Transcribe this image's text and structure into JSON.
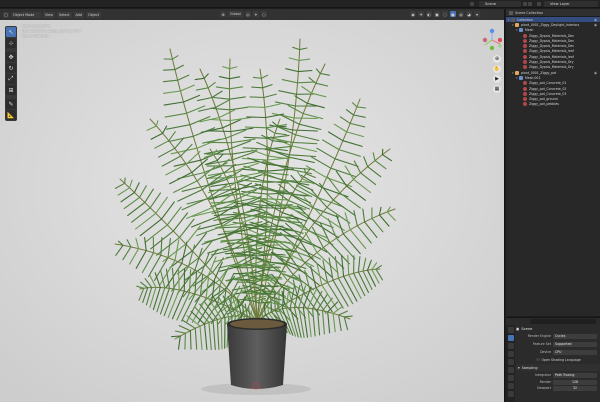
{
  "topbar": {
    "scene_name": "Scene",
    "view_layer": "View Layer"
  },
  "viewport_header": {
    "mode": "Object Mode",
    "menus": [
      "View",
      "Select",
      "Add",
      "Object"
    ],
    "orientation": "Global",
    "shading_label": "Options"
  },
  "viewport_overlay": {
    "lines": [
      "User Perspective",
      "(1) Collection | Ziggy_Bambo_Palm",
      "Scene Statistics"
    ]
  },
  "outliner": {
    "title": "Scene Collection",
    "rows": [
      {
        "label": "Collection",
        "indent": 0,
        "icon": "coll",
        "selected": true
      },
      {
        "label": "plant_0001_Ziggy_Daylight_Interiors",
        "indent": 1,
        "icon": "obj",
        "selected": false
      },
      {
        "label": "Mesh",
        "indent": 2,
        "icon": "mod",
        "selected": false
      },
      {
        "label": "Ziggy_Dypsis_Materials_Dec",
        "indent": 3,
        "icon": "mat",
        "selected": false
      },
      {
        "label": "Ziggy_Dypsis_Materials_Dec",
        "indent": 3,
        "icon": "mat",
        "selected": false
      },
      {
        "label": "Ziggy_Dypsis_Materials_Dec",
        "indent": 3,
        "icon": "mat",
        "selected": false
      },
      {
        "label": "Ziggy_Dypsis_Materials_leaf",
        "indent": 3,
        "icon": "mat",
        "selected": false
      },
      {
        "label": "Ziggy_Dypsis_Materials_leaf",
        "indent": 3,
        "icon": "mat",
        "selected": false
      },
      {
        "label": "Ziggy_Dypsis_Materials_Dry",
        "indent": 3,
        "icon": "mat",
        "selected": false
      },
      {
        "label": "Ziggy_Dypsis_Materials_Dry",
        "indent": 3,
        "icon": "mat",
        "selected": false
      },
      {
        "label": "plant_0001_Ziggy_pot",
        "indent": 1,
        "icon": "obj",
        "selected": false
      },
      {
        "label": "Mesh.001",
        "indent": 2,
        "icon": "mod",
        "selected": false
      },
      {
        "label": "Ziggy_pot_Concrete_01",
        "indent": 3,
        "icon": "mat",
        "selected": false
      },
      {
        "label": "Ziggy_pot_Concrete_02",
        "indent": 3,
        "icon": "mat",
        "selected": false
      },
      {
        "label": "Ziggy_pot_Concrete_03",
        "indent": 3,
        "icon": "mat",
        "selected": false
      },
      {
        "label": "Ziggy_pot_ground",
        "indent": 3,
        "icon": "mat",
        "selected": false
      },
      {
        "label": "Ziggy_pot_pebbles",
        "indent": 3,
        "icon": "mat",
        "selected": false
      }
    ]
  },
  "properties": {
    "section_title": "Scene",
    "render_engine_label": "Render Engine",
    "render_engine_value": "Cycles",
    "feature_set_label": "Feature Set",
    "feature_set_value": "Supported",
    "device_label": "Device",
    "device_value": "CPU",
    "open_shading_label": "Open Shading Language",
    "sampling_label": "Sampling",
    "integrator_label": "Integrator",
    "integrator_value": "Path Tracing",
    "render_label": "Render",
    "render_value": "128",
    "viewport_label": "Viewport",
    "viewport_value": "32"
  },
  "colors": {
    "accent": "#4772b3",
    "leaf": "#4e7a3e",
    "pot": "#4a4a4a"
  }
}
